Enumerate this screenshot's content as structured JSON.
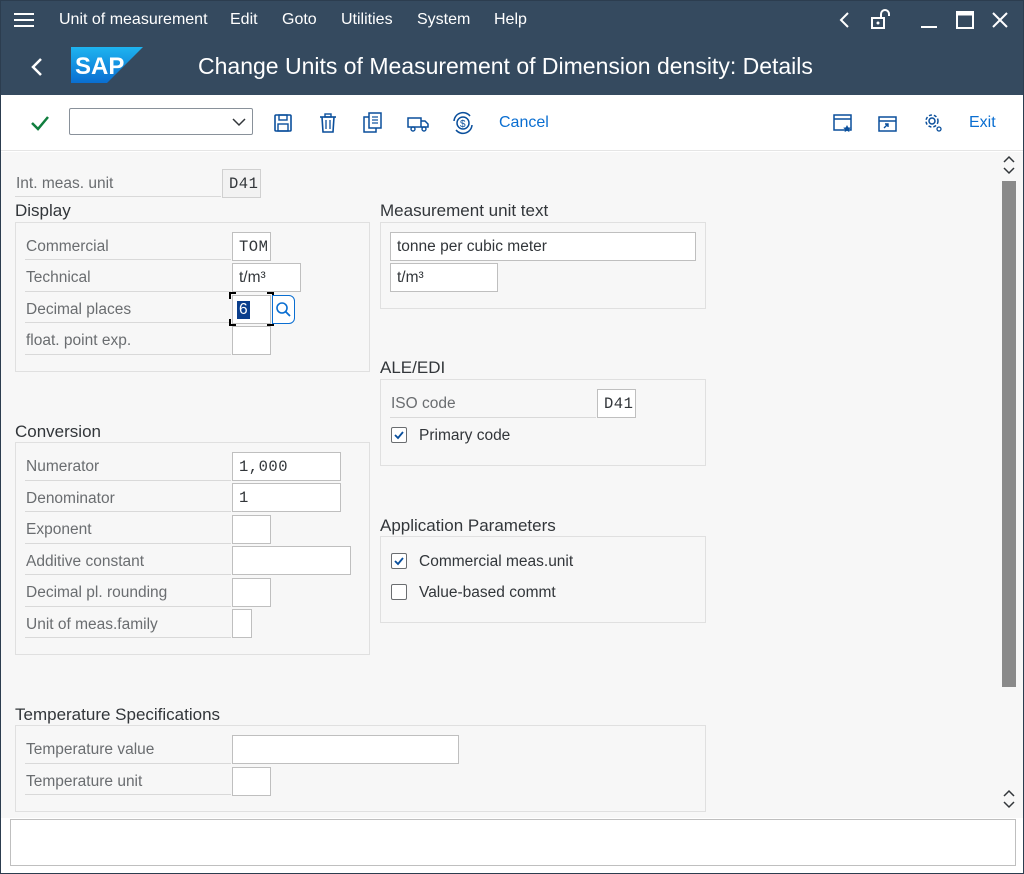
{
  "menubar": {
    "items": [
      "Unit of measurement",
      "Edit",
      "Goto",
      "Utilities",
      "System",
      "Help"
    ]
  },
  "titlebar": {
    "logo": "SAP",
    "title": "Change Units of Measurement of Dimension density: Details"
  },
  "toolbar": {
    "command_value": "",
    "cancel_label": "Cancel",
    "exit_label": "Exit"
  },
  "header": {
    "int_meas_unit_label": "Int. meas. unit",
    "int_meas_unit_value": "D41"
  },
  "display": {
    "title": "Display",
    "commercial_label": "Commercial",
    "commercial_value": "TOM",
    "technical_label": "Technical",
    "technical_value": "t/m³",
    "decimal_places_label": "Decimal places",
    "decimal_places_value": "6",
    "float_point_exp_label": "float. point exp.",
    "float_point_exp_value": ""
  },
  "measurement_unit_text": {
    "title": "Measurement unit text",
    "long_text": "tonne per cubic meter",
    "short_text": "t/m³"
  },
  "ale_edi": {
    "title": "ALE/EDI",
    "iso_code_label": "ISO code",
    "iso_code_value": "D41",
    "primary_code_label": "Primary code",
    "primary_code_checked": true
  },
  "conversion": {
    "title": "Conversion",
    "numerator_label": "Numerator",
    "numerator_value": "1,000",
    "denominator_label": "Denominator",
    "denominator_value": "1",
    "exponent_label": "Exponent",
    "exponent_value": "",
    "additive_constant_label": "Additive constant",
    "additive_constant_value": "",
    "decimal_rounding_label": "Decimal pl. rounding",
    "decimal_rounding_value": "",
    "family_label": "Unit of meas.family",
    "family_value": ""
  },
  "application_parameters": {
    "title": "Application Parameters",
    "commercial_label": "Commercial meas.unit",
    "commercial_checked": true,
    "value_based_label": "Value-based commt",
    "value_based_checked": false
  },
  "temperature": {
    "title": "Temperature Specifications",
    "value_label": "Temperature value",
    "value": "",
    "unit_label": "Temperature unit",
    "unit": ""
  },
  "colors": {
    "shell": "#354a5f",
    "accent": "#0a6ed1",
    "check_green": "#107e3e"
  }
}
